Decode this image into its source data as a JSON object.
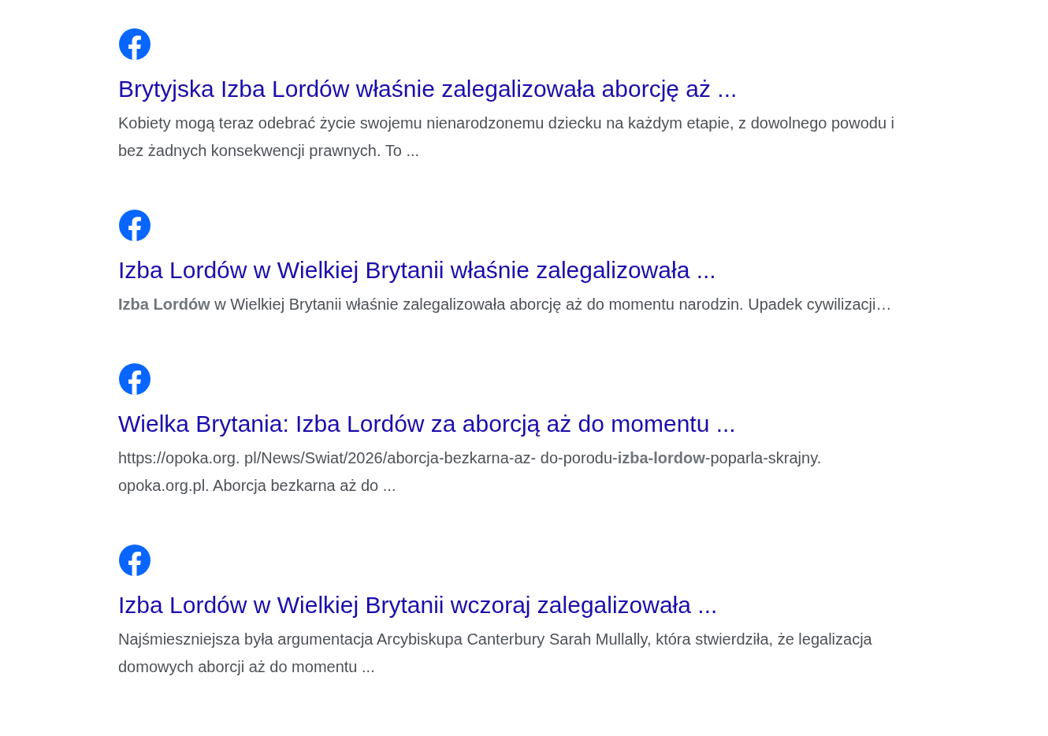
{
  "results": [
    {
      "title": "Brytyjska Izba Lordów właśnie zalegalizowała aborcję aż ...",
      "snippet": "Kobiety mogą teraz odebrać życie swojemu nienarodzonemu dziecku na każdym etapie, z dowolnego powodu i bez żadnych konsekwencji prawnych. To ..."
    },
    {
      "title": "Izba Lordów w Wielkiej Brytanii właśnie zalegalizowała ...",
      "snippet": "**Izba Lordów** w Wielkiej Brytanii właśnie zalegalizowała aborcję aż do momentu narodzin. Upadek cywilizacji…"
    },
    {
      "title": "Wielka Brytania: Izba Lordów za aborcją aż do momentu ...",
      "snippet": "https://opoka.org. pl/News/Swiat/2026/aborcja-bezkarna-az- do-porodu-**izba-lordow**-poparla-skrajny. opoka.org.pl. Aborcja bezkarna aż do ..."
    },
    {
      "title": "Izba Lordów w Wielkiej Brytanii wczoraj zalegalizowała ...",
      "snippet": "Najśmieszniejsza była argumentacja Arcybiskupa Canterbury Sarah Mullally, która stwierdziła, że legalizacja domowych aborcji aż do momentu ..."
    }
  ]
}
